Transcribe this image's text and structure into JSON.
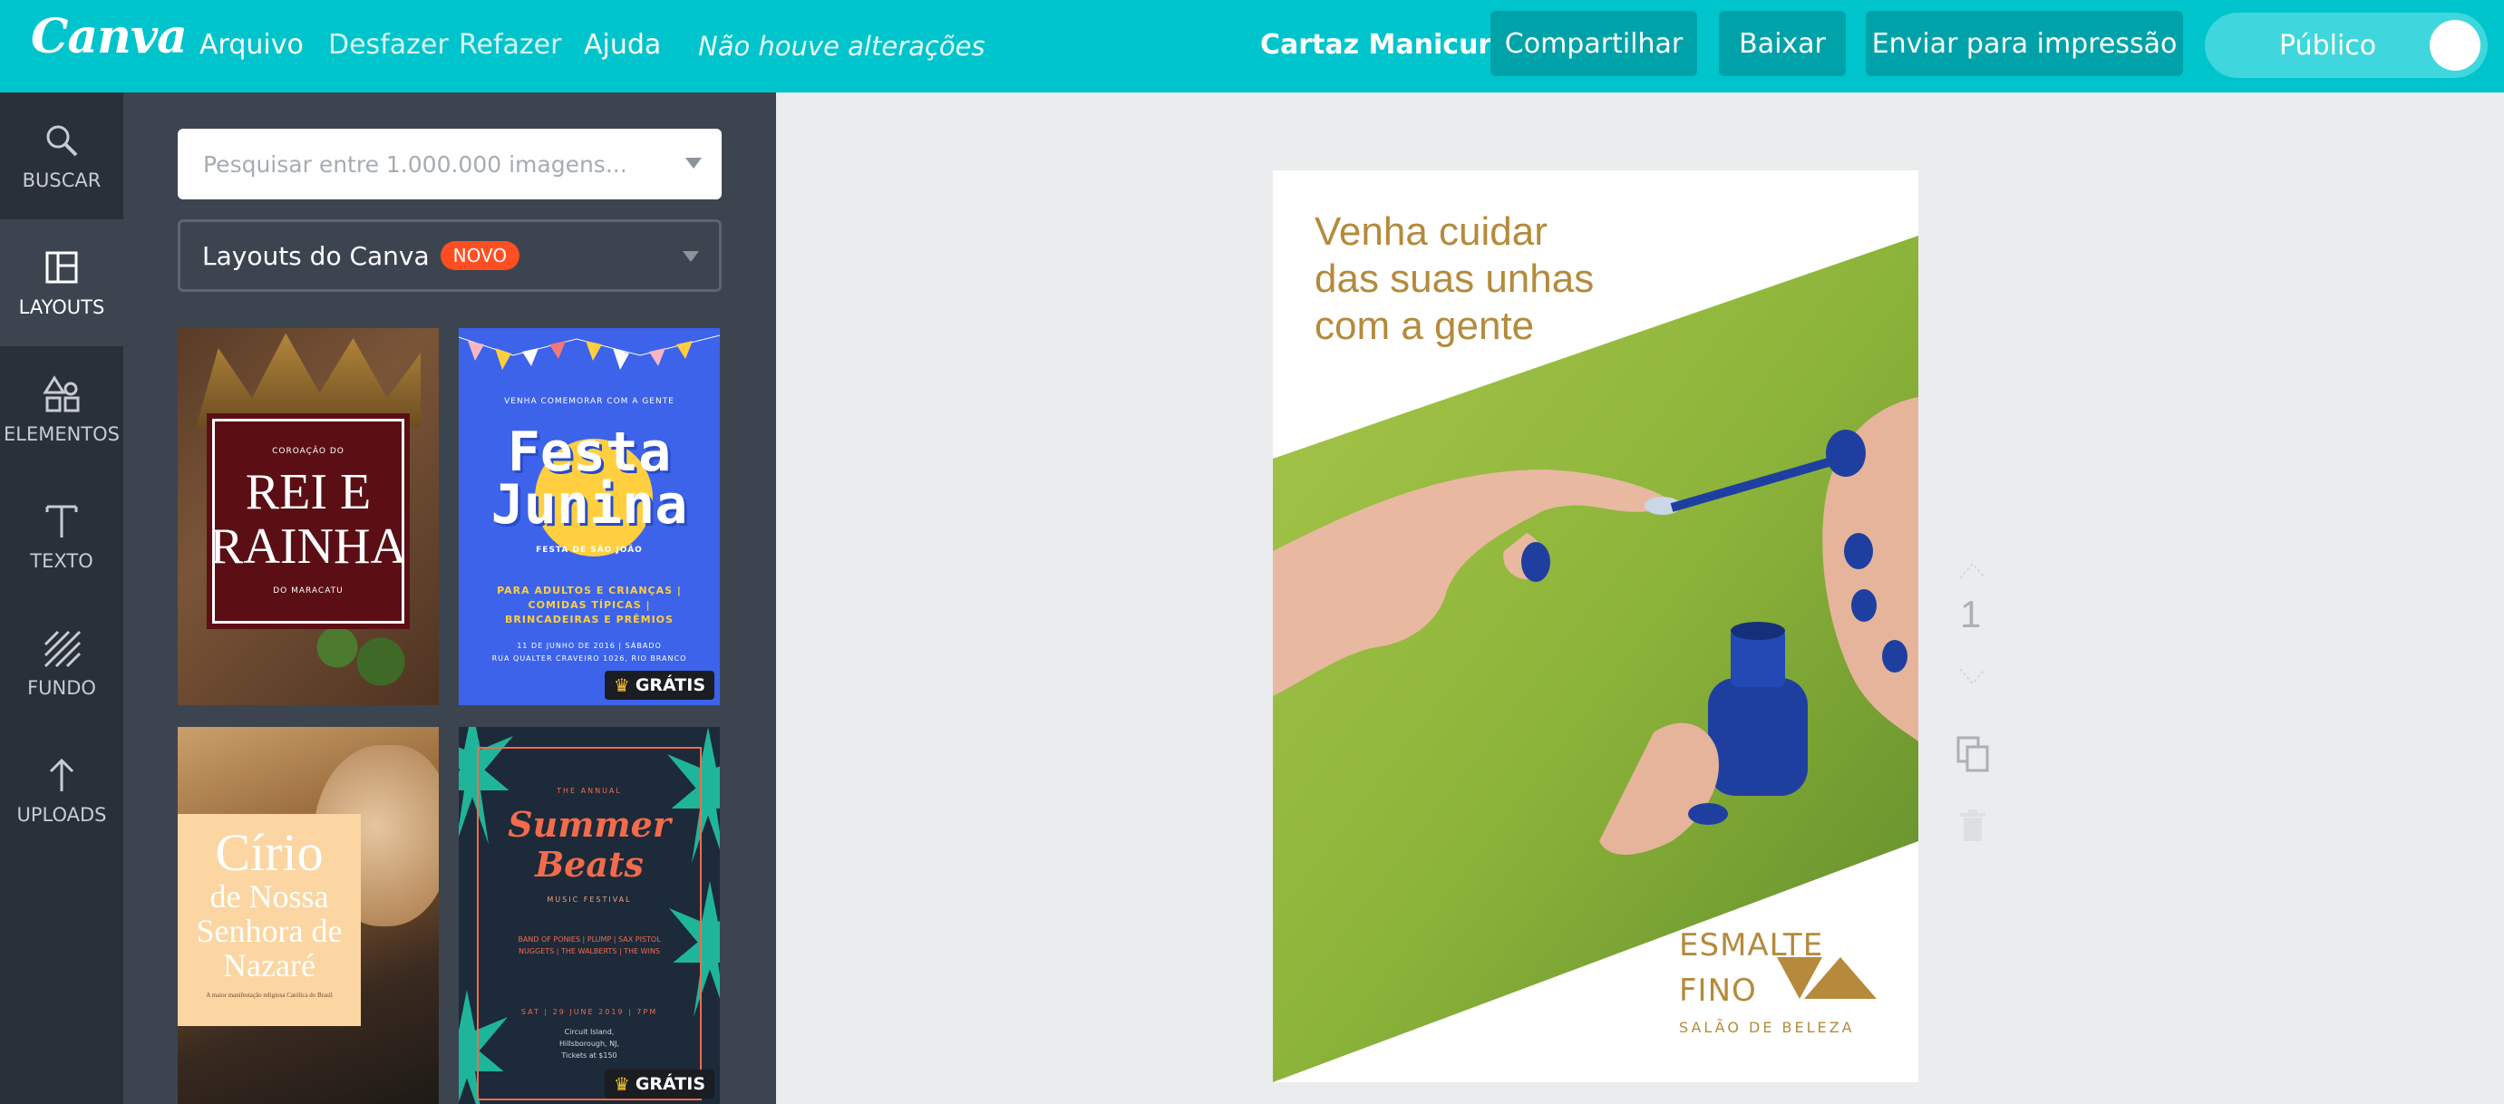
{
  "topbar": {
    "logo": "Canva",
    "menu": [
      "Arquivo",
      "Desfazer",
      "Refazer",
      "Ajuda"
    ],
    "status": "Não houve alterações",
    "doc_title": "Cartaz Manicure",
    "share_label": "Compartilhar",
    "download_label": "Baixar",
    "print_label": "Enviar para impressão",
    "visibility_label": "Público"
  },
  "rail": {
    "items": [
      {
        "label": "BUSCAR",
        "icon": "search-icon"
      },
      {
        "label": "LAYOUTS",
        "icon": "layouts-icon"
      },
      {
        "label": "ELEMENTOS",
        "icon": "shapes-icon"
      },
      {
        "label": "TEXTO",
        "icon": "text-icon"
      },
      {
        "label": "FUNDO",
        "icon": "background-icon"
      },
      {
        "label": "UPLOADS",
        "icon": "upload-icon"
      }
    ]
  },
  "panel": {
    "search_placeholder": "Pesquisar entre 1.000.000 imagens...",
    "layout_select": "Layouts do Canva",
    "new_badge": "NOVO",
    "free_badge": "GRÁTIS",
    "templates": {
      "t1": {
        "small": "COROAÇÃO DO",
        "title": "REI E RAINHA",
        "footer": "DO MARACATU"
      },
      "t2": {
        "top": "VENHA COMEMORAR COM A GENTE",
        "title": "Festa Junina",
        "sub": "FESTA DE SÃO JOÃO",
        "body": "PARA ADULTOS E CRIANÇAS | COMIDAS TÍPICAS | BRINCADEIRAS E PRÊMIOS",
        "date": "11 DE JUNHO DE 2016 | SÁBADO",
        "address": "RUA QUALTER CRAVEIRO 1026, RIO BRANCO"
      },
      "t3": {
        "title": "Círio",
        "sub": "de Nossa Senhora de Nazaré",
        "tiny": "A maior manifestação religiosa Católica do Brasil"
      },
      "t4": {
        "top": "THE ANNUAL",
        "title": "Summer Beats",
        "sub": "MUSIC FESTIVAL",
        "bands": "BAND OF PONIES | PLUMP | SAX PISTOL NUGGETS | THE WALBERTS | THE WINS",
        "date": "SAT | 29 JUNE 2019 | 7PM",
        "venue": "Circuit Island, Hillsborough, NJ, Tickets at $150"
      }
    }
  },
  "canvas": {
    "headline": [
      "Venha cuidar",
      "das suas unhas",
      "com a gente"
    ],
    "brand_line1": "ESMALTE",
    "brand_line2": "FINO",
    "brand_line3": "SALÃO DE BELEZA",
    "page_number": "1",
    "colors": {
      "accent": "#00c4cc",
      "gold": "#b58a3c",
      "green": "#8db43a",
      "polish": "#1f3fa0"
    }
  }
}
